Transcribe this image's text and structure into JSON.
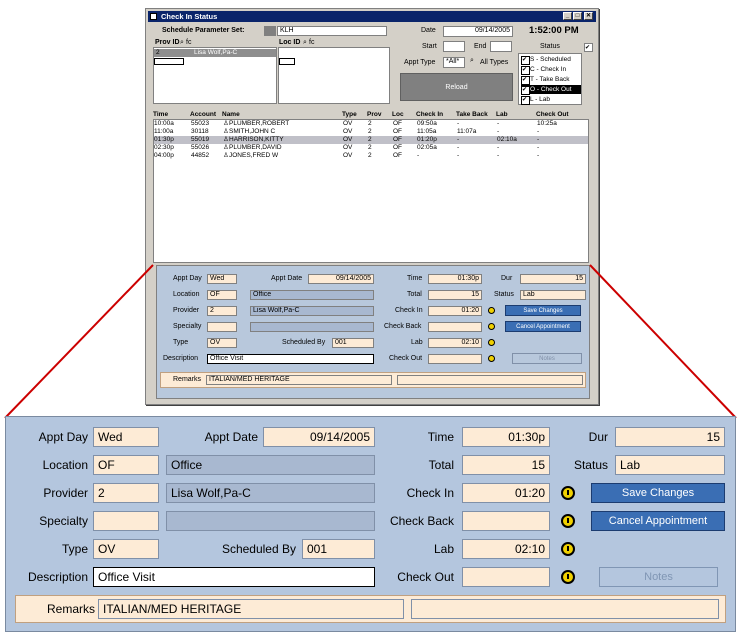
{
  "window": {
    "title": "Check In Status",
    "controls": [
      "_",
      "□",
      "✕"
    ]
  },
  "params": {
    "set_label": "Schedule Parameter Set:",
    "set_value": "KLH",
    "prov_id_label": "Prov ID",
    "loc_id_label": "Loc ID",
    "search_hint": "fc",
    "prov_list": [
      {
        "id": "2",
        "name": "Lisa Wolf,Pa-C"
      },
      {
        "id": "",
        "name": ""
      }
    ]
  },
  "header": {
    "date_label": "Date",
    "date_value": "09/14/2005",
    "time": "1:52:00 PM",
    "start_label": "Start",
    "end_label": "End",
    "appt_type_label": "Appt Type",
    "appt_type_value": "*All*",
    "all_types_label": "All Types",
    "reload_label": "Reload",
    "status_title": "Status"
  },
  "status_options": [
    {
      "label": "S - Scheduled",
      "selected": false
    },
    {
      "label": "C - Check In",
      "selected": false
    },
    {
      "label": "T - Take Back",
      "selected": false
    },
    {
      "label": "O - Check Out",
      "selected": true
    },
    {
      "label": "L - Lab",
      "selected": false
    }
  ],
  "grid": {
    "columns": [
      "Time",
      "Account",
      "Name",
      "Type",
      "Prov",
      "Loc",
      "Check In",
      "Take Back",
      "Lab",
      "Check Out"
    ],
    "rows": [
      {
        "time": "10:00a",
        "account": "55023",
        "name": "PLUMBER,ROBERT",
        "type": "OV",
        "prov": "2",
        "loc": "OF",
        "checkin": "09:50a",
        "takeback": "-",
        "lab": "-",
        "checkout": "10:25a",
        "selected": false
      },
      {
        "time": "11:00a",
        "account": "30118",
        "name": "SMITH,JOHN C",
        "type": "OV",
        "prov": "2",
        "loc": "OF",
        "checkin": "11:05a",
        "takeback": "11:07a",
        "lab": "-",
        "checkout": "-",
        "selected": false
      },
      {
        "time": "01:30p",
        "account": "55019",
        "name": "HARRISON,KITTY",
        "type": "OV",
        "prov": "2",
        "loc": "OF",
        "checkin": "01:20p",
        "takeback": "-",
        "lab": "02:10a",
        "checkout": "-",
        "selected": true
      },
      {
        "time": "02:30p",
        "account": "55026",
        "name": "PLUMBER,DAVID",
        "type": "OV",
        "prov": "2",
        "loc": "OF",
        "checkin": "02:05a",
        "takeback": "-",
        "lab": "-",
        "checkout": "-",
        "selected": false
      },
      {
        "time": "04:00p",
        "account": "44852",
        "name": "JONES,FRED W",
        "type": "OV",
        "prov": "2",
        "loc": "OF",
        "checkin": "-",
        "takeback": "-",
        "lab": "-",
        "checkout": "-",
        "selected": false
      }
    ]
  },
  "detail": {
    "appt_day_label": "Appt Day",
    "appt_day": "Wed",
    "appt_date_label": "Appt Date",
    "appt_date": "09/14/2005",
    "time_label": "Time",
    "time": "01:30p",
    "dur_label": "Dur",
    "dur": "15",
    "location_label": "Location",
    "location_code": "OF",
    "location_name": "Office",
    "total_label": "Total",
    "total": "15",
    "status_label": "Status",
    "status": "Lab",
    "provider_label": "Provider",
    "provider_code": "2",
    "provider_name": "Lisa Wolf,Pa-C",
    "checkin_label": "Check In",
    "checkin": "01:20",
    "specialty_label": "Specialty",
    "specialty_code": "",
    "specialty_name": "",
    "checkback_label": "Check Back",
    "checkback": "",
    "type_label": "Type",
    "type": "OV",
    "scheduled_by_label": "Scheduled By",
    "scheduled_by": "001",
    "lab_label": "Lab",
    "lab": "02:10",
    "description_label": "Description",
    "description": "Office Visit",
    "checkout_label": "Check Out",
    "checkout": "",
    "remarks_label": "Remarks",
    "remarks": "ITALIAN/MED HERITAGE",
    "remarks2": "",
    "save_label": "Save Changes",
    "cancel_label": "Cancel Appointment",
    "notes_label": "Notes"
  },
  "colors": {
    "zoom_callout": "#cc0000",
    "peach": "#fdebd6",
    "panel": "#b4c6de",
    "button": "#3a6eb4"
  }
}
